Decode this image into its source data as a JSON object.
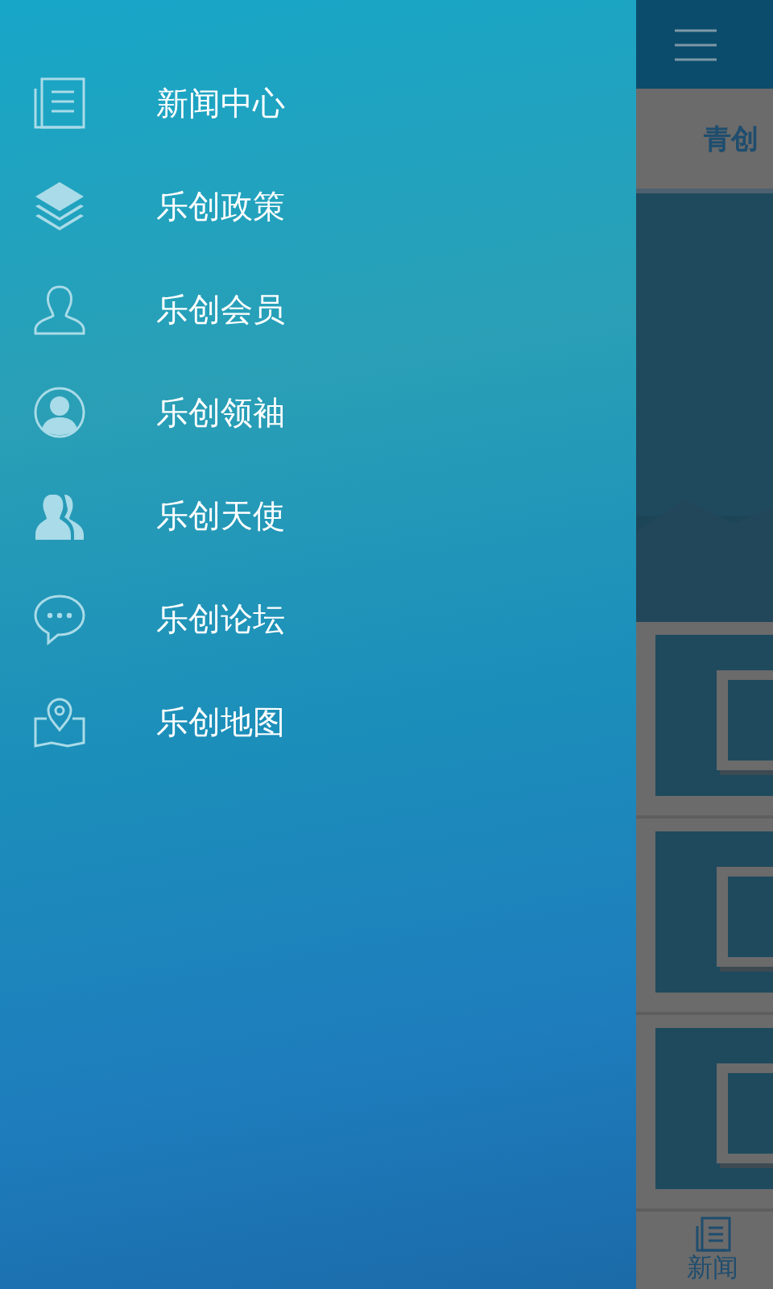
{
  "drawer": {
    "items": [
      {
        "kind": "news",
        "label": "新闻中心"
      },
      {
        "kind": "layers",
        "label": "乐创政策"
      },
      {
        "kind": "member",
        "label": "乐创会员"
      },
      {
        "kind": "leader",
        "label": "乐创领袖"
      },
      {
        "kind": "angel",
        "label": "乐创天使"
      },
      {
        "kind": "forum",
        "label": "乐创论坛"
      },
      {
        "kind": "map",
        "label": "乐创地图"
      }
    ]
  },
  "main": {
    "tab": "青创",
    "bottom_nav": [
      {
        "label": "新闻"
      }
    ]
  }
}
